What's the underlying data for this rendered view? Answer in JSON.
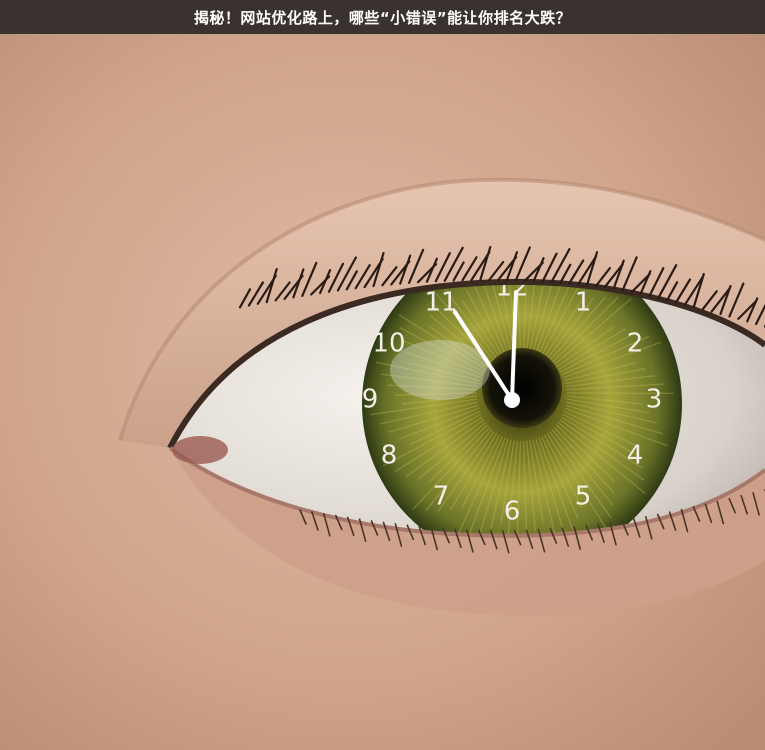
{
  "header": {
    "title": "揭秘！网站优化路上，哪些“小错误”能让你排名大跌？"
  },
  "photo": {
    "subject": "eye-with-clock-iris",
    "clock": {
      "numerals": [
        "12",
        "1",
        "2",
        "3",
        "4",
        "5",
        "6",
        "7",
        "8",
        "9",
        "10",
        "11"
      ],
      "time": "11:59"
    },
    "colors": {
      "skin": "#d2ab93",
      "iris_outer": "#5d6a22",
      "iris_inner": "#9aa13b",
      "pupil": "#101010",
      "header_bg": "#3a322e"
    }
  }
}
